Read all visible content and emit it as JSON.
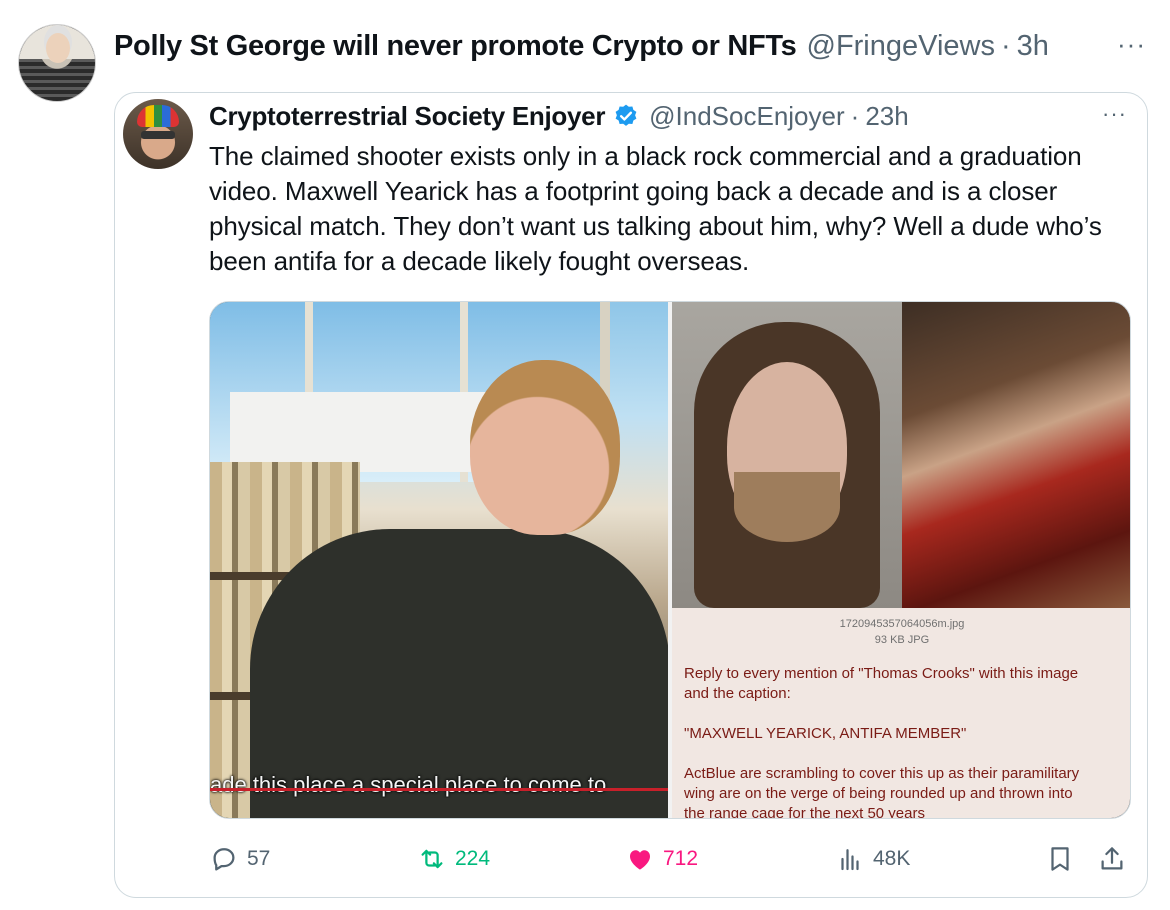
{
  "main_tweet": {
    "display_name": "Polly St George will never promote Crypto or NFTs",
    "handle": "@FringeViews",
    "separator": "·",
    "time": "3h",
    "more": "···"
  },
  "quoted_tweet": {
    "display_name": "Cryptoterrestrial Society Enjoyer",
    "handle": "@IndSocEnjoyer",
    "separator": "·",
    "time": "23h",
    "more": "···",
    "verified_color": "#1d9bf0",
    "text": "The claimed shooter exists only in a black rock commercial and a graduation video. Maxwell Yearick has a footprint going back a decade and is a closer physical match. They don’t want us talking about him, why? Well a dude who’s been antifa for a decade likely fought overseas.",
    "media": {
      "left_subtitle": "ade this place a special place to come to",
      "right_filename": "1720945357064056m.jpg",
      "right_filesize": "93 KB JPG",
      "right_caption": "Reply to every mention of \"Thomas Crooks\" with this image\nand the caption:\n\n\"MAXWELL YEARICK, ANTIFA MEMBER\"\n\nActBlue are scrambling to cover this up as their paramilitary\nwing are on the verge of being rounded up and thrown into\nthe range cage for the next 50 years"
    }
  },
  "actions": {
    "replies": "57",
    "reposts": "224",
    "likes": "712",
    "views": "48K",
    "icons": [
      "reply-icon",
      "repost-icon",
      "heart-icon",
      "views-icon",
      "bookmark-icon",
      "share-icon"
    ],
    "colors": {
      "neutral": "#536471",
      "repost": "#00ba7c",
      "like": "#f91880"
    }
  }
}
